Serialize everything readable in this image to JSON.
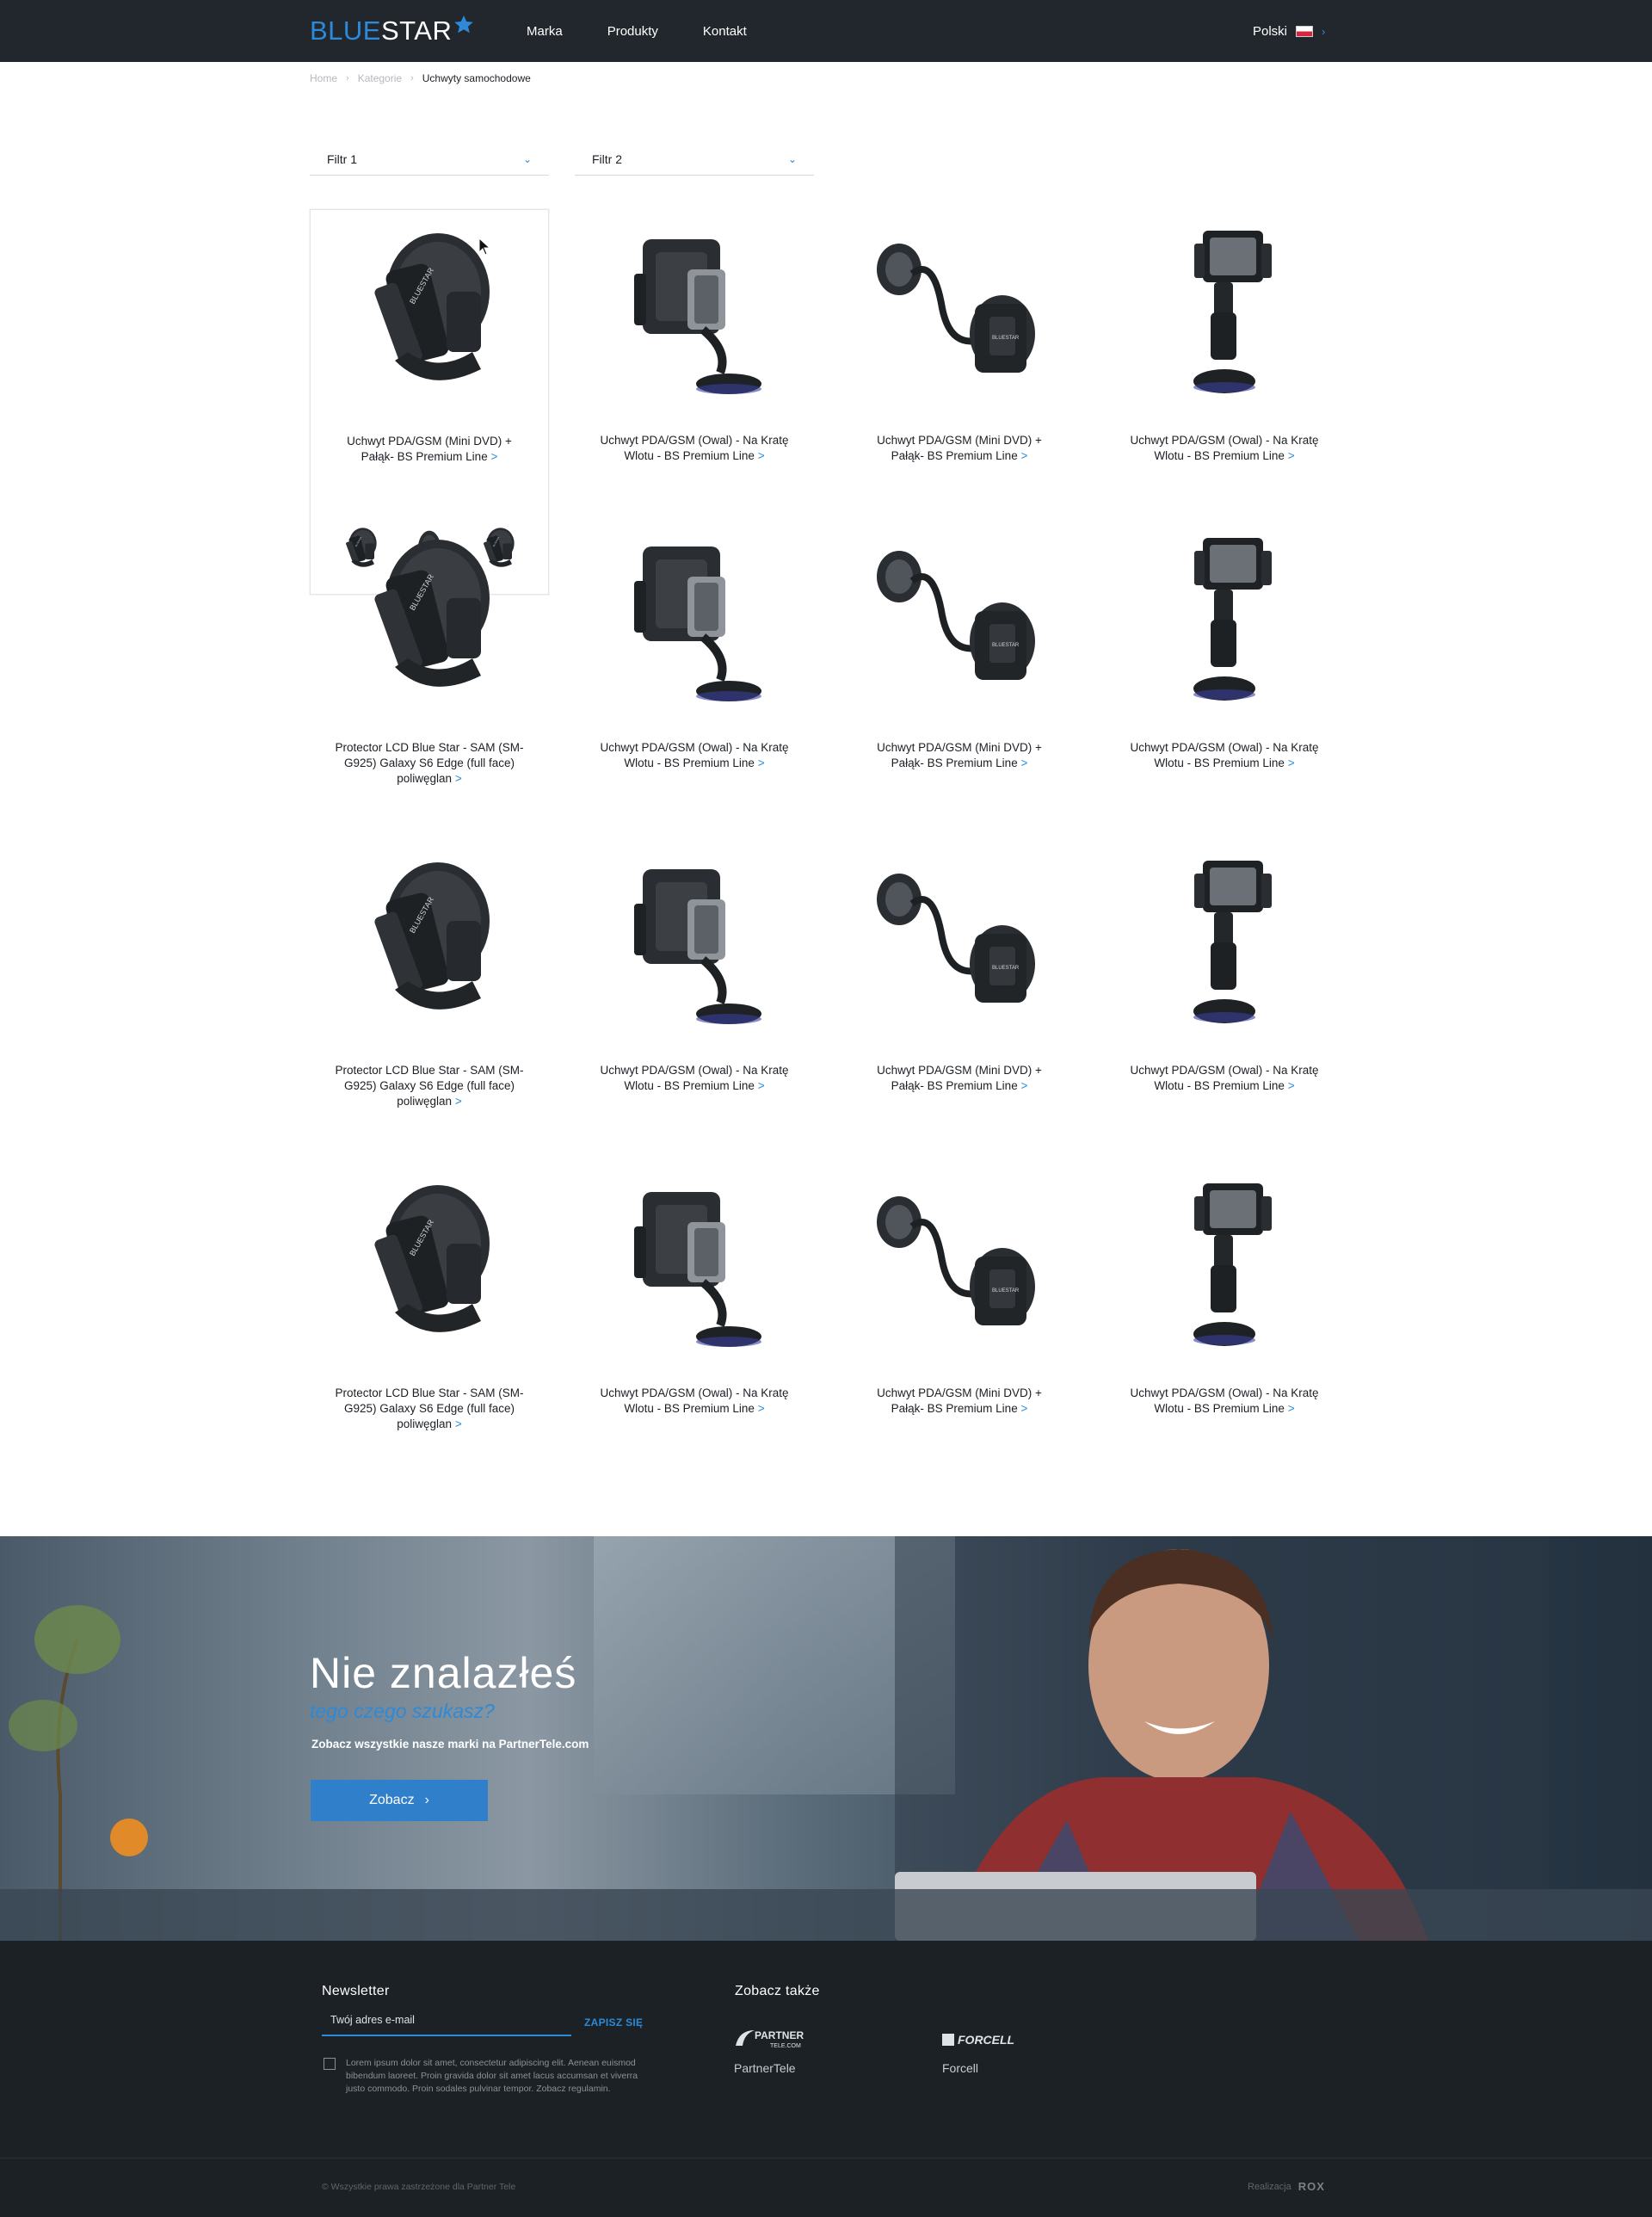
{
  "header": {
    "logo_part1": "BLUE",
    "logo_part2": "STAR",
    "nav": [
      "Marka",
      "Produkty",
      "Kontakt"
    ],
    "language": "Polski"
  },
  "breadcrumb": {
    "items": [
      "Home",
      "Kategorie",
      "Uchwyty samochodowe"
    ]
  },
  "filters": [
    "Filtr 1",
    "Filtr 2"
  ],
  "products": {
    "more": ">",
    "row1": [
      "Uchwyt PDA/GSM (Mini DVD) + Pałąk- BS Premium Line",
      "Uchwyt PDA/GSM (Owal) - Na Kratę Wlotu - BS Premium Line",
      "Uchwyt PDA/GSM (Mini DVD) + Pałąk- BS Premium Line",
      "Uchwyt PDA/GSM (Owal) - Na Kratę Wlotu - BS Premium Line"
    ],
    "row2": [
      "Protector LCD Blue Star - SAM (SM-G925) Galaxy S6 Edge (full face) poliwęglan",
      "Uchwyt PDA/GSM (Owal) - Na Kratę Wlotu - BS Premium Line",
      "Uchwyt PDA/GSM (Mini DVD) + Pałąk- BS Premium Line",
      "Uchwyt PDA/GSM (Owal) - Na Kratę Wlotu - BS Premium Line"
    ],
    "row3": [
      "Protector LCD Blue Star - SAM (SM-G925) Galaxy S6 Edge (full face) poliwęglan",
      "Uchwyt PDA/GSM (Owal) - Na Kratę Wlotu - BS Premium Line",
      "Uchwyt PDA/GSM (Mini DVD) + Pałąk- BS Premium Line",
      "Uchwyt PDA/GSM (Owal) - Na Kratę Wlotu - BS Premium Line"
    ],
    "row4": [
      "Protector LCD Blue Star - SAM (SM-G925) Galaxy S6 Edge (full face) poliwęglan",
      "Uchwyt PDA/GSM (Owal) - Na Kratę Wlotu - BS Premium Line",
      "Uchwyt PDA/GSM (Mini DVD) + Pałąk- BS Premium Line",
      "Uchwyt PDA/GSM (Owal) - Na Kratę Wlotu - BS Premium Line"
    ]
  },
  "hero": {
    "title": "Nie znalazłeś",
    "subtitle": "tego czego szukasz?",
    "note": "Zobacz wszystkie nasze marki na PartnerTele.com",
    "button": "Zobacz"
  },
  "footer": {
    "newsletter_title": "Newsletter",
    "email_placeholder": "Twój adres e-mail",
    "subscribe": "ZAPISZ SIĘ",
    "consent": "Lorem ipsum dolor sit amet, consectetur adipiscing elit. Aenean euismod bibendum laoreet. Proin gravida dolor sit amet lacus accumsan et viverra justo commodo. Proin sodales pulvinar tempor. Zobacz regulamin.",
    "see_also": "Zobacz także",
    "brands": [
      "PartnerTele",
      "Forcell"
    ],
    "partner_logo_line1": "PARTNER",
    "partner_logo_line2": "TELE.COM",
    "forcell_logo": "FORCELL",
    "copyright": "© Wszystkie prawa zastrzeżone dla Partner Tele",
    "credit_label": "Realizacja",
    "credit_brand": "ROX"
  },
  "colors": {
    "accent": "#2c8ad8",
    "header_bg": "#22272d",
    "footer_bg": "#1c2126"
  }
}
